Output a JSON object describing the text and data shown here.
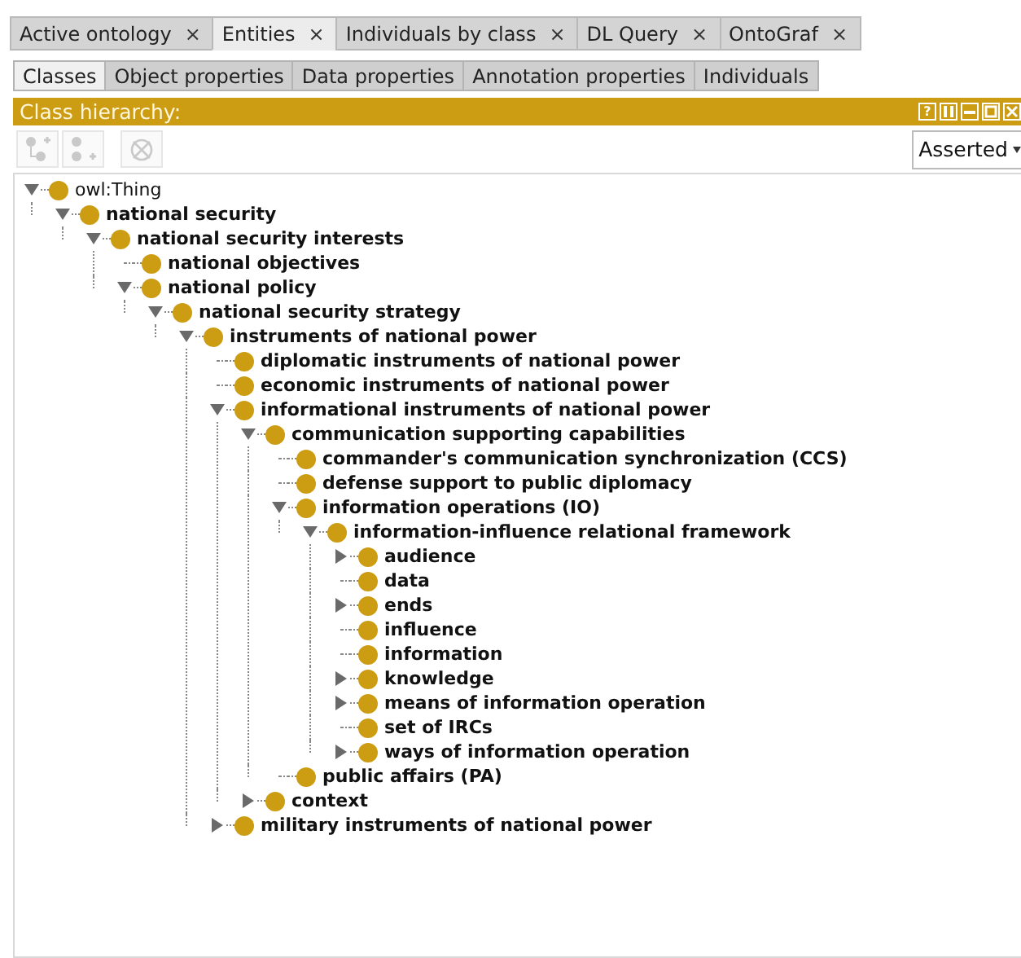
{
  "main_tabs": [
    {
      "label": "Active ontology",
      "close": "×",
      "selected": false
    },
    {
      "label": "Entities",
      "close": "×",
      "selected": true
    },
    {
      "label": "Individuals by class",
      "close": "×",
      "selected": false
    },
    {
      "label": "DL Query",
      "close": "×",
      "selected": false
    },
    {
      "label": "OntoGraf",
      "close": "×",
      "selected": false
    }
  ],
  "entity_tabs": [
    {
      "label": "Classes",
      "selected": true
    },
    {
      "label": "Object properties",
      "selected": false
    },
    {
      "label": "Data properties",
      "selected": false
    },
    {
      "label": "Annotation properties",
      "selected": false
    },
    {
      "label": "Individuals",
      "selected": false
    }
  ],
  "view": {
    "title": "Class hierarchy:",
    "help": "?"
  },
  "toolbar": {
    "buttons": [
      {
        "kind": "add-subclass",
        "disabled": true
      },
      {
        "kind": "add-sibling",
        "disabled": true
      },
      {
        "kind": "delete",
        "disabled": true
      }
    ],
    "mode": "Asserted"
  },
  "tree": [
    {
      "label": "owl:Thing",
      "bold": false,
      "kind": "branch",
      "expanded": true,
      "children": [
        {
          "label": "national security",
          "bold": true,
          "kind": "branch",
          "expanded": true,
          "children": [
            {
              "label": "national security interests",
              "bold": true,
              "kind": "branch",
              "expanded": true,
              "children": [
                {
                  "label": "national objectives",
                  "bold": true,
                  "kind": "leaf"
                },
                {
                  "label": "national policy",
                  "bold": true,
                  "kind": "branch",
                  "expanded": true,
                  "children": [
                    {
                      "label": "national security strategy",
                      "bold": true,
                      "kind": "branch",
                      "expanded": true,
                      "children": [
                        {
                          "label": "instruments of national power",
                          "bold": true,
                          "kind": "branch",
                          "expanded": true,
                          "children": [
                            {
                              "label": "diplomatic instruments of national power",
                              "bold": true,
                              "kind": "leaf"
                            },
                            {
                              "label": "economic instruments of national power",
                              "bold": true,
                              "kind": "leaf"
                            },
                            {
                              "label": "informational instruments of national power",
                              "bold": true,
                              "kind": "branch",
                              "expanded": true,
                              "children": [
                                {
                                  "label": "communication supporting capabilities",
                                  "bold": true,
                                  "kind": "branch",
                                  "expanded": true,
                                  "children": [
                                    {
                                      "label": "commander's communication synchronization (CCS)",
                                      "bold": true,
                                      "kind": "leaf"
                                    },
                                    {
                                      "label": "defense support to public diplomacy",
                                      "bold": true,
                                      "kind": "leaf"
                                    },
                                    {
                                      "label": "information operations (IO)",
                                      "bold": true,
                                      "kind": "branch",
                                      "expanded": true,
                                      "children": [
                                        {
                                          "label": "information-influence relational framework",
                                          "bold": true,
                                          "kind": "branch",
                                          "expanded": true,
                                          "children": [
                                            {
                                              "label": "audience",
                                              "bold": true,
                                              "kind": "branch",
                                              "expanded": false
                                            },
                                            {
                                              "label": "data",
                                              "bold": true,
                                              "kind": "leaf"
                                            },
                                            {
                                              "label": "ends",
                                              "bold": true,
                                              "kind": "branch",
                                              "expanded": false
                                            },
                                            {
                                              "label": "influence",
                                              "bold": true,
                                              "kind": "leaf"
                                            },
                                            {
                                              "label": "information",
                                              "bold": true,
                                              "kind": "leaf"
                                            },
                                            {
                                              "label": "knowledge",
                                              "bold": true,
                                              "kind": "branch",
                                              "expanded": false
                                            },
                                            {
                                              "label": "means of information operation",
                                              "bold": true,
                                              "kind": "branch",
                                              "expanded": false
                                            },
                                            {
                                              "label": "set of IRCs",
                                              "bold": true,
                                              "kind": "leaf"
                                            },
                                            {
                                              "label": "ways of information operation",
                                              "bold": true,
                                              "kind": "branch",
                                              "expanded": false
                                            }
                                          ]
                                        }
                                      ]
                                    },
                                    {
                                      "label": "public affairs (PA)",
                                      "bold": true,
                                      "kind": "leaf"
                                    }
                                  ]
                                },
                                {
                                  "label": "context",
                                  "bold": true,
                                  "kind": "branch",
                                  "expanded": false
                                }
                              ]
                            },
                            {
                              "label": "military instruments of national power",
                              "bold": true,
                              "kind": "branch",
                              "expanded": false
                            }
                          ]
                        }
                      ]
                    }
                  ]
                }
              ]
            }
          ]
        }
      ]
    }
  ]
}
